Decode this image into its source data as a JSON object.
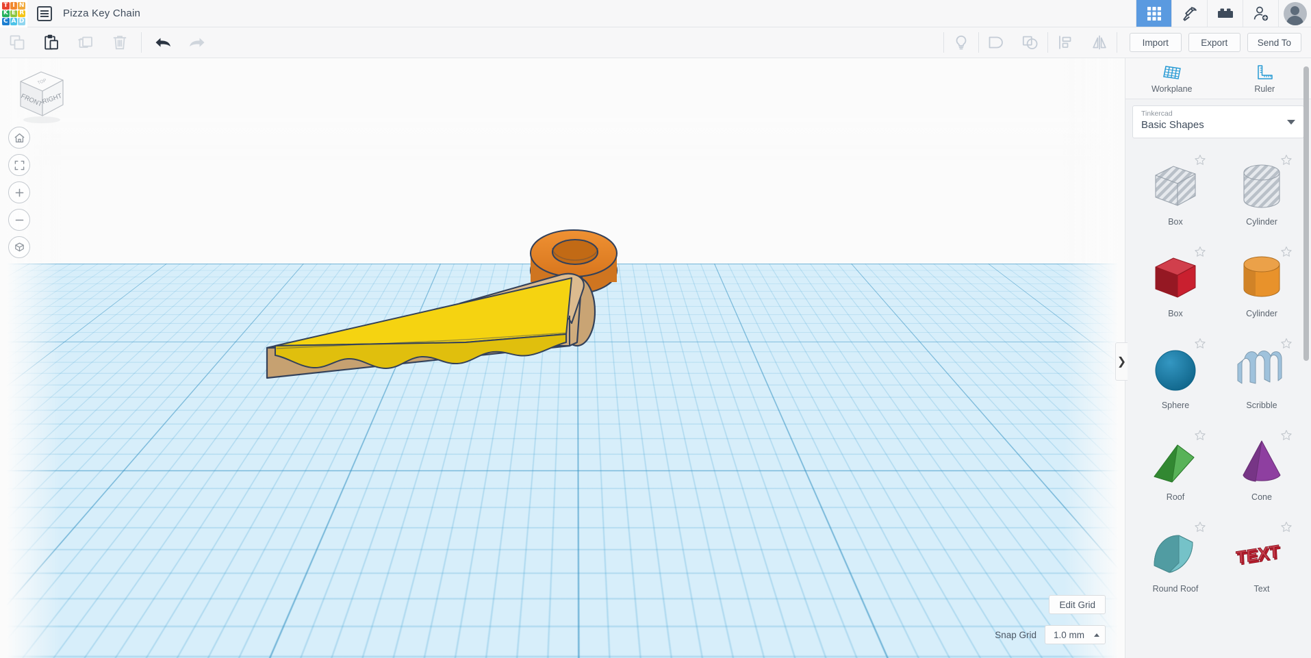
{
  "header": {
    "logo_letters": [
      {
        "ch": "T",
        "color": "#e8422f"
      },
      {
        "ch": "I",
        "color": "#f2892f"
      },
      {
        "ch": "N",
        "color": "#f2a93b"
      },
      {
        "ch": "K",
        "color": "#24b15c"
      },
      {
        "ch": "E",
        "color": "#8cc63e"
      },
      {
        "ch": "R",
        "color": "#f5c518"
      },
      {
        "ch": "C",
        "color": "#1d7fd1"
      },
      {
        "ch": "A",
        "color": "#4dc3e8"
      },
      {
        "ch": "D",
        "color": "#8fd6f0"
      }
    ],
    "doc_list_icon": "document-list-icon",
    "title": "Pizza Key Chain",
    "tools": [
      {
        "name": "designs-grid-icon",
        "label": "Designs",
        "active": true
      },
      {
        "name": "codeblocks-pickaxe-icon",
        "label": "Codeblocks",
        "active": false
      },
      {
        "name": "brick-blocks-icon",
        "label": "Blocks",
        "active": false
      },
      {
        "name": "add-user-icon",
        "label": "Invite",
        "active": false
      }
    ],
    "avatar_label": "Account"
  },
  "toolbar": {
    "left_buttons": [
      {
        "name": "copy-button",
        "label": "Copy",
        "enabled": false
      },
      {
        "name": "paste-button",
        "label": "Paste",
        "enabled": true
      },
      {
        "name": "duplicate-button",
        "label": "Duplicate",
        "enabled": false
      },
      {
        "name": "delete-button",
        "label": "Delete",
        "enabled": false
      }
    ],
    "history_buttons": [
      {
        "name": "undo-button",
        "label": "Undo",
        "enabled": true
      },
      {
        "name": "redo-button",
        "label": "Redo",
        "enabled": false
      }
    ],
    "right_icon_buttons": [
      {
        "name": "light-bulb-button",
        "label": "Light"
      },
      {
        "name": "group-button",
        "label": "Group"
      },
      {
        "name": "ungroup-button",
        "label": "Ungroup"
      },
      {
        "name": "align-button",
        "label": "Align"
      },
      {
        "name": "mirror-button",
        "label": "Mirror"
      }
    ],
    "import_label": "Import",
    "export_label": "Export",
    "send_to_label": "Send To"
  },
  "canvas": {
    "viewcube": {
      "front_label": "FRONT",
      "right_label": "RIGHT",
      "top_label": "TOP"
    },
    "nav_buttons": [
      {
        "name": "home-view-button",
        "label": "Home view"
      },
      {
        "name": "fit-to-view-button",
        "label": "Fit all in view"
      },
      {
        "name": "zoom-in-button",
        "label": "Zoom in"
      },
      {
        "name": "zoom-out-button",
        "label": "Zoom out"
      },
      {
        "name": "perspective-toggle-button",
        "label": "Switch to orthographic view"
      }
    ],
    "edit_grid_label": "Edit Grid",
    "snap_grid_label": "Snap Grid",
    "snap_grid_value": "1.0 mm",
    "model": {
      "name": "pizza-slice-keychain",
      "crust_color": "#d4b183",
      "cheese_color": "#f5d311",
      "cheese_shadow_color": "#d9bb0c",
      "ring_color": "#e8862a",
      "ring_dark_color": "#c96d18",
      "outline_color": "#33415a"
    },
    "collapse_handle_glyph": "❯",
    "grid": {
      "fill_color": "#d7eefa",
      "major_line_color": "#2d8cbe",
      "minor_line_color": "#46a5d2"
    }
  },
  "right_panel": {
    "workplane_label": "Workplane",
    "ruler_label": "Ruler",
    "library_owner": "Tinkercad",
    "library_name": "Basic Shapes",
    "shapes": [
      {
        "name": "Box",
        "style": "hole-box",
        "color": "#c8ced5",
        "starred": false
      },
      {
        "name": "Cylinder",
        "style": "hole-cylinder",
        "color": "#c8ced5",
        "starred": false
      },
      {
        "name": "Box",
        "style": "box",
        "color": "#c9202f",
        "starred": false
      },
      {
        "name": "Cylinder",
        "style": "cylinder",
        "color": "#e8922b",
        "starred": false
      },
      {
        "name": "Sphere",
        "style": "sphere",
        "color": "#1386b8",
        "starred": false
      },
      {
        "name": "Scribble",
        "style": "scribble",
        "color": "#9fc2dc",
        "starred": false
      },
      {
        "name": "Roof",
        "style": "roof",
        "color": "#3da63d",
        "starred": false
      },
      {
        "name": "Cone",
        "style": "cone",
        "color": "#8e3fa0",
        "starred": false
      },
      {
        "name": "Round Roof",
        "style": "round-roof",
        "color": "#5fb8bf",
        "starred": false
      },
      {
        "name": "Text",
        "style": "text",
        "color": "#bb1b2c",
        "starred": false
      }
    ]
  }
}
